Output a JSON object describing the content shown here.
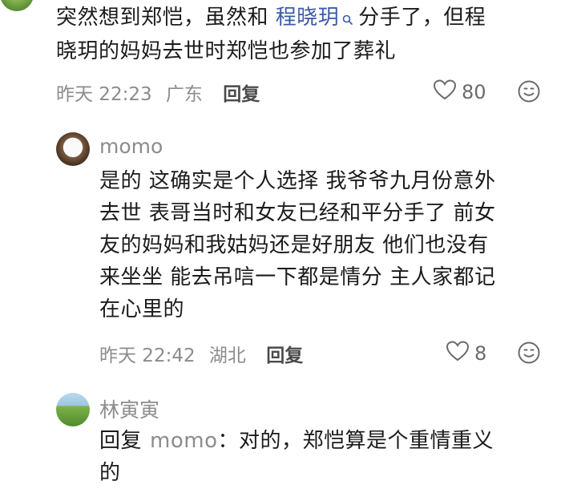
{
  "comment1": {
    "text_before_link": "突然想到郑恺，虽然和 ",
    "link_text": "程晓玥",
    "line1_after_link": "分手了，但程",
    "line2": "晓玥的妈妈去世时郑恺也参加了葬礼",
    "date": "昨天 22:23",
    "location": "广东",
    "reply_label": "回复",
    "likes": "80"
  },
  "comment2": {
    "username": "momo",
    "lines": [
      "是的 这确实是个人选择 我爷爷九月份意外",
      "去世 表哥当时和女友已经和平分手了 前女",
      "友的妈妈和我姑妈还是好朋友 他们也没有",
      "来坐坐 能去吊唁一下都是情分 主人家都记",
      "在心里的"
    ],
    "date": "昨天 22:42",
    "location": "湖北",
    "reply_label": "回复",
    "likes": "8"
  },
  "comment3": {
    "username": "林寅寅",
    "reply_prefix": "回复",
    "reply_to": "momo",
    "line1_text": "：对的，郑恺算是个重情重义",
    "line2_text": "的"
  },
  "icons": {
    "heart": "heart-outline-icon",
    "emoji": "smiley-icon",
    "search": "search-small-icon"
  }
}
